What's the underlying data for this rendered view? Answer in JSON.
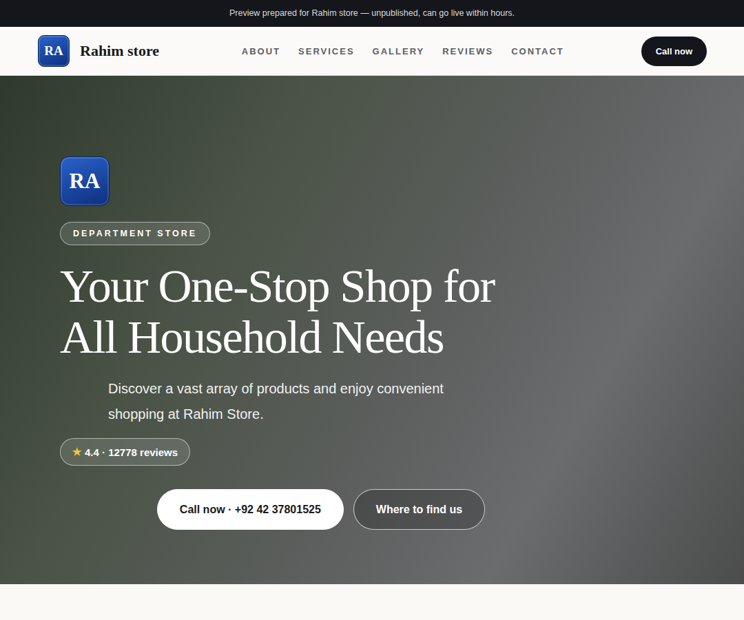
{
  "banner": {
    "text": "Preview prepared for Rahim store — unpublished, can go live within hours."
  },
  "header": {
    "logo": "RA",
    "brand": "Rahim store",
    "nav": [
      {
        "label": "ABOUT"
      },
      {
        "label": "SERVICES"
      },
      {
        "label": "GALLERY"
      },
      {
        "label": "REVIEWS"
      },
      {
        "label": "CONTACT"
      }
    ],
    "button": "Call now"
  },
  "hero": {
    "logo": "RA",
    "category": "DEPARTMENT STORE",
    "title": "Your One-Stop Shop for All Household Needs",
    "subtitle": "Discover a vast array of products and enjoy convenient shopping at Rahim Store.",
    "rating": {
      "star": "★",
      "text": "4.4 · 12778 reviews"
    },
    "buttons": [
      {
        "label": "Call now · +92 42 37801525",
        "kind": "primary"
      },
      {
        "label": "Where to find us",
        "kind": "outline"
      }
    ]
  }
}
